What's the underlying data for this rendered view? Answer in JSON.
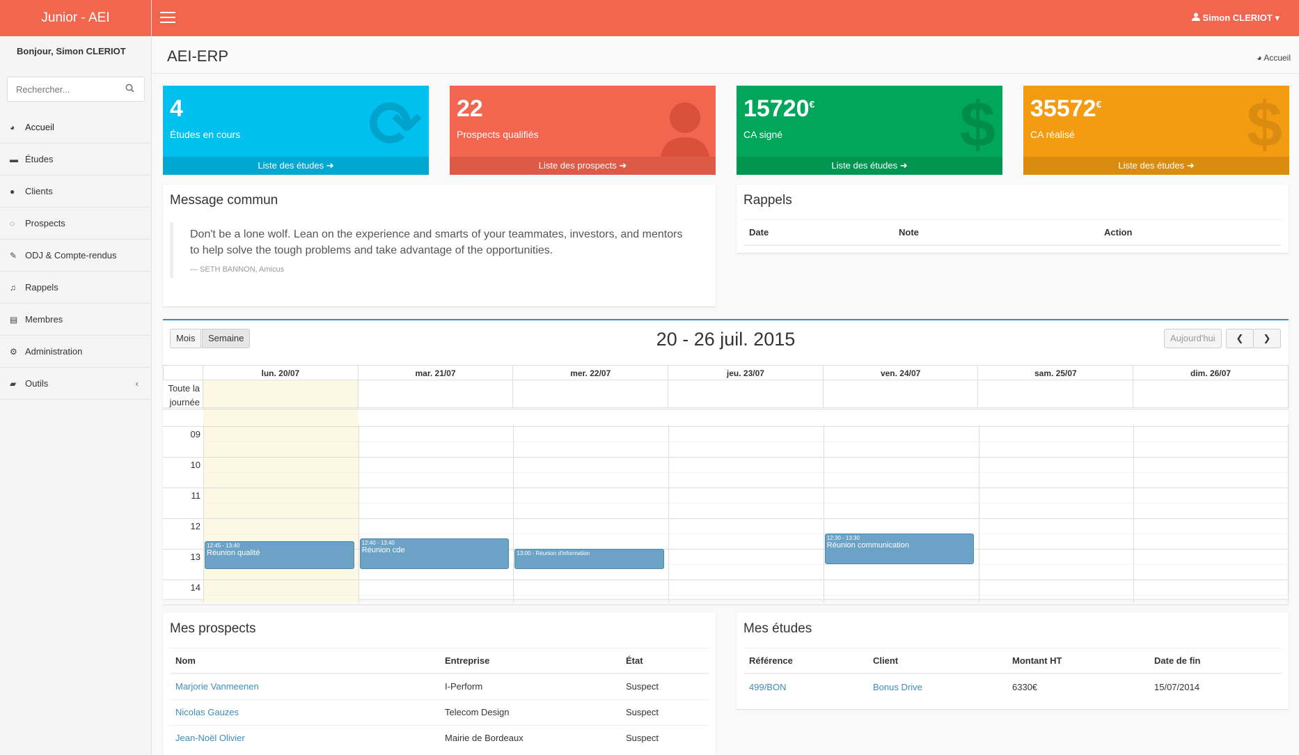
{
  "brand": "Junior - AEI",
  "greeting": "Bonjour, Simon CLERIOT",
  "search": {
    "placeholder": "Rechercher..."
  },
  "sidebar": {
    "items": [
      {
        "label": "Accueil",
        "icon": "dashboard-icon"
      },
      {
        "label": "Études",
        "icon": "briefcase-icon"
      },
      {
        "label": "Clients",
        "icon": "users-icon"
      },
      {
        "label": "Prospects",
        "icon": "comments-icon"
      },
      {
        "label": "ODJ & Compte-rendus",
        "icon": "edit-icon"
      },
      {
        "label": "Rappels",
        "icon": "bell-icon"
      },
      {
        "label": "Membres",
        "icon": "book-icon"
      },
      {
        "label": "Administration",
        "icon": "cogs-icon"
      },
      {
        "label": "Outils",
        "icon": "folder-icon"
      }
    ]
  },
  "topbar": {
    "user": "Simon CLERIOT"
  },
  "header": {
    "title": "AEI-ERP",
    "breadcrumb": "Accueil"
  },
  "stats": [
    {
      "value": "4",
      "unit": "",
      "label": "Études en cours",
      "link": "Liste des études",
      "color": "#00c0ef"
    },
    {
      "value": "22",
      "unit": "",
      "label": "Prospects qualifiés",
      "link": "Liste des prospects",
      "color": "#f26650"
    },
    {
      "value": "15720",
      "unit": "€",
      "label": "CA signé",
      "link": "Liste des études",
      "color": "#00a65a"
    },
    {
      "value": "35572",
      "unit": "€",
      "label": "CA réalisé",
      "link": "Liste des études",
      "color": "#f39c12"
    }
  ],
  "message": {
    "title": "Message commun",
    "quote": "Don't be a lone wolf. Lean on the experience and smarts of your teammates, investors, and mentors to help solve the tough problems and take advantage of the opportunities.",
    "author": "— SETH BANNON, Amicus"
  },
  "rappels": {
    "title": "Rappels",
    "columns": [
      "Date",
      "Note",
      "Action"
    ]
  },
  "calendar": {
    "title": "20 - 26 juil. 2015",
    "btn_month": "Mois",
    "btn_week": "Semaine",
    "btn_today": "Aujourd'hui",
    "allday": "Toute la journée",
    "days": [
      "lun. 20/07",
      "mar. 21/07",
      "mer. 22/07",
      "jeu. 23/07",
      "ven. 24/07",
      "sam. 25/07",
      "dim. 26/07"
    ],
    "hours": [
      "09",
      "10",
      "11",
      "12",
      "13",
      "14"
    ],
    "events": [
      {
        "day": 0,
        "time": "12:45 - 13:40",
        "title": "Réunion qualité",
        "start": 12.75,
        "end": 13.667
      },
      {
        "day": 1,
        "time": "12:40 - 13:40",
        "title": "Réunion cde",
        "start": 12.667,
        "end": 13.667
      },
      {
        "day": 2,
        "time": "13:00 - Réunion d'information",
        "title": "",
        "start": 13.0,
        "end": 13.667
      },
      {
        "day": 4,
        "time": "12:30 - 13:30",
        "title": "Réunion communication",
        "start": 12.5,
        "end": 13.5
      }
    ]
  },
  "prospects": {
    "title": "Mes prospects",
    "columns": [
      "Nom",
      "Entreprise",
      "État"
    ],
    "rows": [
      [
        "Marjorie Vanmeenen",
        "I-Perform",
        "Suspect"
      ],
      [
        "Nicolas Gauzes",
        "Telecom Design",
        "Suspect"
      ],
      [
        "Jean-Noël Olivier",
        "Mairie de Bordeaux",
        "Suspect"
      ]
    ]
  },
  "etudes": {
    "title": "Mes études",
    "columns": [
      "Référence",
      "Client",
      "Montant HT",
      "Date de fin"
    ],
    "rows": [
      [
        "499/BON",
        "Bonus Drive",
        "6330€",
        "15/07/2014"
      ]
    ]
  }
}
